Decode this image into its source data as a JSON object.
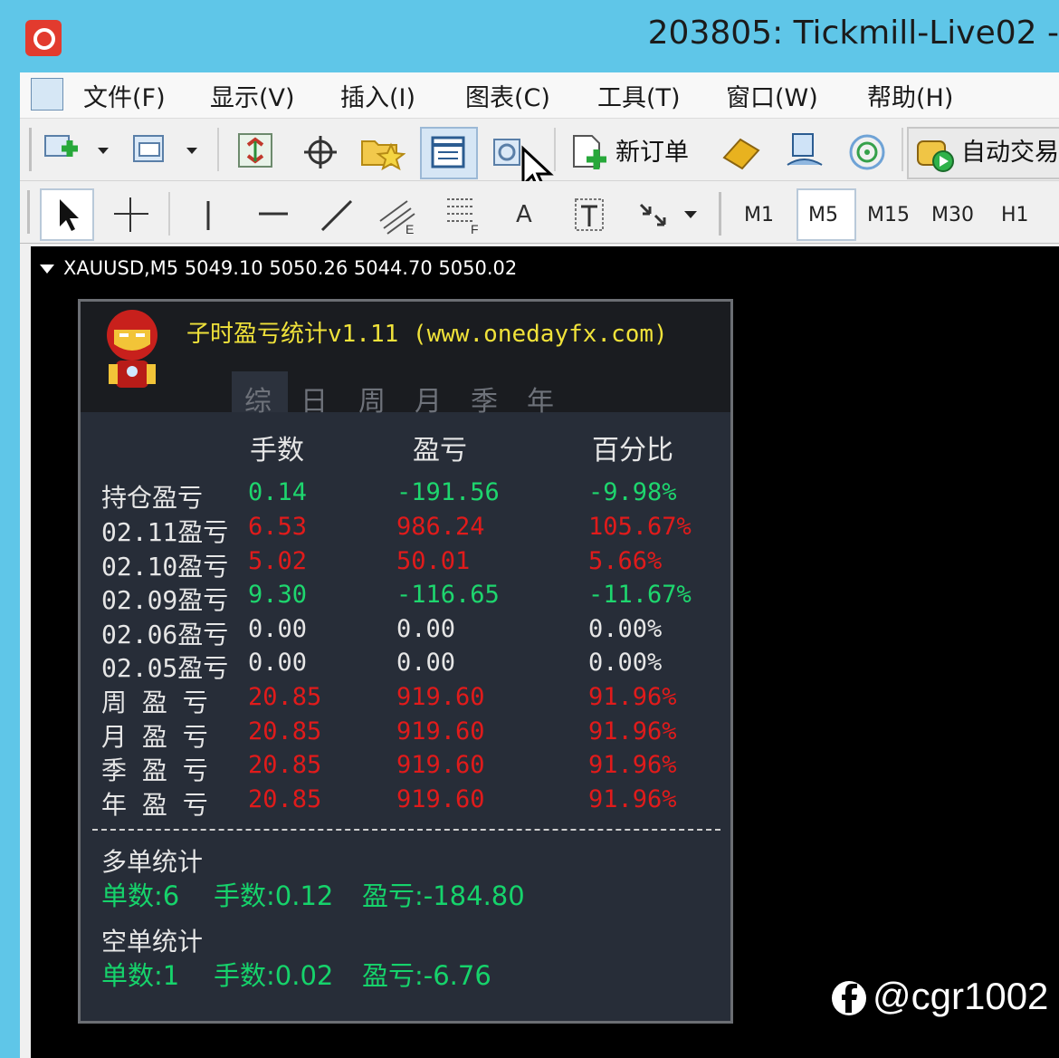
{
  "window": {
    "title": "203805: Tickmill-Live02 -"
  },
  "menu": [
    "文件(F)",
    "显示(V)",
    "插入(I)",
    "图表(C)",
    "工具(T)",
    "窗口(W)",
    "帮助(H)"
  ],
  "toolbar": {
    "new_order": "新订单",
    "auto_trade": "自动交易"
  },
  "draw_toolbar": {
    "text_tool": "A",
    "timeframes": [
      "M1",
      "M5",
      "M15",
      "M30",
      "H1"
    ],
    "active_timeframe": "M5"
  },
  "chart": {
    "symbol_line": "XAUUSD,M5  5049.10 5050.26 5044.70 5050.02"
  },
  "panel": {
    "title": "子时盈亏统计v1.11 (www.onedayfx.com)",
    "tabs": [
      "综",
      "日",
      "周",
      "月",
      "季",
      "年"
    ],
    "active_tab": "综",
    "headers": [
      "手数",
      "盈亏",
      "百分比"
    ],
    "rows": [
      {
        "label": "持仓盈亏",
        "lots": "0.14",
        "pnl": "-191.56",
        "pct": "-9.98%",
        "color": "#1ed66e"
      },
      {
        "label": "02.11盈亏",
        "lots": "6.53",
        "pnl": "986.24",
        "pct": "105.67%",
        "color": "#e01b1b"
      },
      {
        "label": "02.10盈亏",
        "lots": "5.02",
        "pnl": "50.01",
        "pct": "5.66%",
        "color": "#e01b1b"
      },
      {
        "label": "02.09盈亏",
        "lots": "9.30",
        "pnl": "-116.65",
        "pct": "-11.67%",
        "color": "#1ed66e"
      },
      {
        "label": "02.06盈亏",
        "lots": "0.00",
        "pnl": "0.00",
        "pct": "0.00%",
        "color": "#e6e6e6"
      },
      {
        "label": "02.05盈亏",
        "lots": "0.00",
        "pnl": "0.00",
        "pct": "0.00%",
        "color": "#e6e6e6"
      },
      {
        "label": "周 盈 亏",
        "lots": "20.85",
        "pnl": "919.60",
        "pct": "91.96%",
        "color": "#e01b1b"
      },
      {
        "label": "月 盈 亏",
        "lots": "20.85",
        "pnl": "919.60",
        "pct": "91.96%",
        "color": "#e01b1b"
      },
      {
        "label": "季 盈 亏",
        "lots": "20.85",
        "pnl": "919.60",
        "pct": "91.96%",
        "color": "#e01b1b"
      },
      {
        "label": "年 盈 亏",
        "lots": "20.85",
        "pnl": "919.60",
        "pct": "91.96%",
        "color": "#e01b1b"
      }
    ],
    "long_stats": {
      "title": "多单统计",
      "count": "单数:6",
      "lots": "手数:0.12",
      "pnl": "盈亏:-184.80"
    },
    "short_stats": {
      "title": "空单统计",
      "count": "单数:1",
      "lots": "手数:0.02",
      "pnl": "盈亏:-6.76"
    }
  },
  "watermark": "@cgr1002"
}
